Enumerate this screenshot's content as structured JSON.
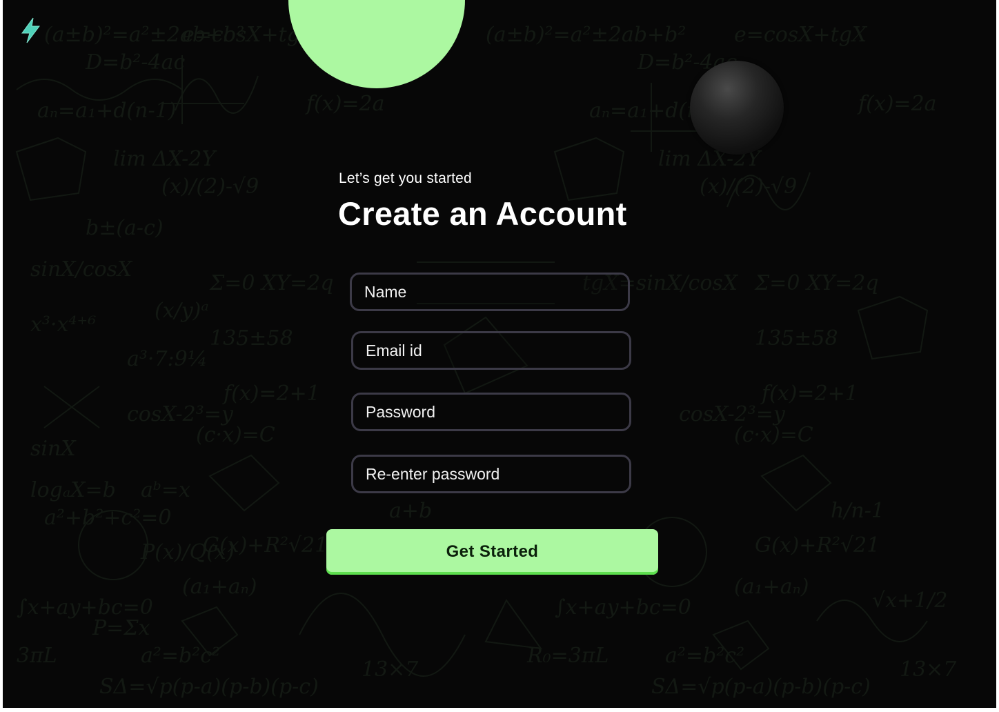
{
  "header": {
    "subtitle": "Let’s get you started",
    "title": "Create an Account"
  },
  "form": {
    "name_placeholder": "Name",
    "email_placeholder": "Email id",
    "password_placeholder": "Password",
    "reenter_placeholder": "Re-enter password",
    "submit_label": "Get Started"
  },
  "theme": {
    "accent": "#acf8a1",
    "accent_dark": "#5ddf4e",
    "background": "#070707",
    "field_border": "#3c3a47",
    "logo_color": "#4fd1b9"
  },
  "icons": {
    "logo": "lightning-bolt-icon"
  }
}
